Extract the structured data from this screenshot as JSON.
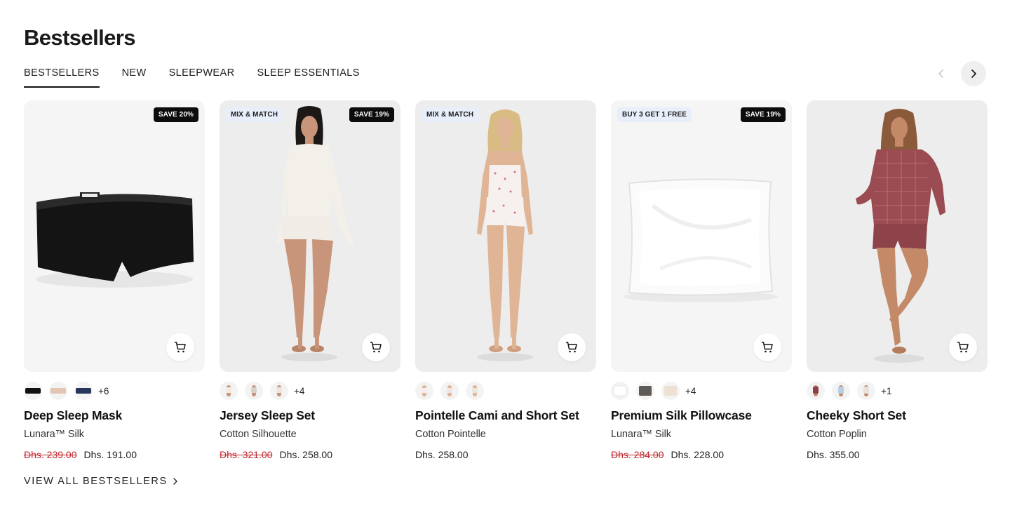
{
  "section": {
    "title": "Bestsellers"
  },
  "tabs": [
    {
      "label": "BESTSELLERS",
      "active": true
    },
    {
      "label": "NEW",
      "active": false
    },
    {
      "label": "SLEEPWEAR",
      "active": false
    },
    {
      "label": "SLEEP ESSENTIALS",
      "active": false
    }
  ],
  "carousel": {
    "prev_icon": "chevron-left-icon",
    "next_icon": "chevron-right-icon"
  },
  "products": [
    {
      "name": "Deep Sleep Mask",
      "subtitle": "Lunara™ Silk",
      "promo_badge": "",
      "save_badge": "SAVE 20%",
      "price_old": "Dhs. 239.00",
      "price_now": "Dhs. 191.00",
      "more_colors": "+6",
      "swatch_colors": [
        "#111111",
        "#e3c5b3",
        "#27355a"
      ],
      "image": "black-eye-mask"
    },
    {
      "name": "Jersey Sleep Set",
      "subtitle": "Cotton Silhouette",
      "promo_badge": "MIX & MATCH",
      "save_badge": "SAVE 19%",
      "price_old": "Dhs. 321.00",
      "price_now": "Dhs. 258.00",
      "more_colors": "+4",
      "swatch_colors": [
        "#f1ebe4",
        "#d9d2cb",
        "#efe5df"
      ],
      "image": "model-cream-jersey-set"
    },
    {
      "name": "Pointelle Cami and Short Set",
      "subtitle": "Cotton Pointelle",
      "promo_badge": "MIX & MATCH",
      "save_badge": "",
      "price_old": "",
      "price_now": "Dhs. 258.00",
      "more_colors": "",
      "swatch_colors": [
        "#f6eeec",
        "#efe6e2",
        "#e9e7e1"
      ],
      "image": "model-white-cami-set"
    },
    {
      "name": "Premium Silk Pillowcase",
      "subtitle": "Lunara™ Silk",
      "promo_badge": "BUY 3 GET 1 FREE",
      "save_badge": "SAVE 19%",
      "price_old": "Dhs. 284.00",
      "price_now": "Dhs. 228.00",
      "more_colors": "+4",
      "swatch_colors": [
        "#f7f7f7",
        "#5e5a57",
        "#eee1d4"
      ],
      "image": "white-silk-pillowcase"
    },
    {
      "name": "Cheeky Short Set",
      "subtitle": "Cotton Poplin",
      "promo_badge": "",
      "save_badge": "",
      "price_old": "",
      "price_now": "Dhs. 355.00",
      "more_colors": "+1",
      "swatch_colors": [
        "#8c3f45",
        "#b9cde3",
        "#e7e3dc"
      ],
      "image": "model-red-gingham-set"
    }
  ],
  "footer_link": {
    "label": "VIEW ALL BESTSELLERS"
  },
  "colors": {
    "sale_price": "#c0262d",
    "badge_dark": "#0c0c0c",
    "badge_promo": "#e8eefa"
  }
}
